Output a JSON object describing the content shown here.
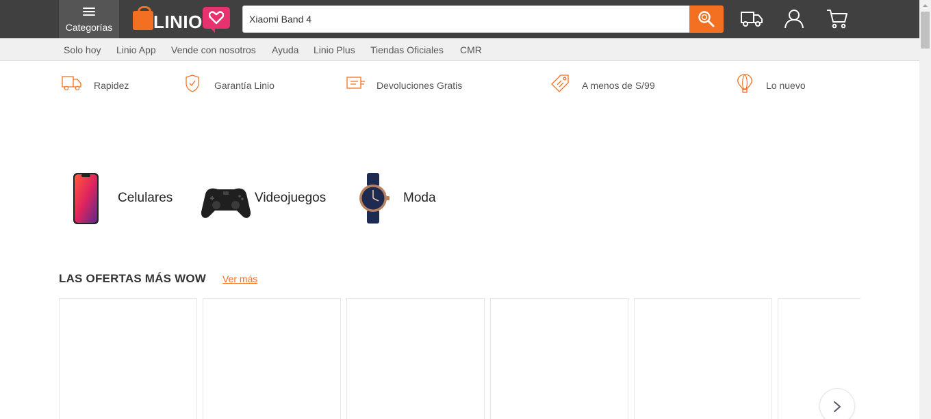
{
  "header": {
    "categories_label": "Categorías",
    "logo_text": "LINIO",
    "search_value": "Xiaomi Band 4"
  },
  "subnav": [
    "Solo hoy",
    "Linio App",
    "Vende con nosotros",
    "Ayuda",
    "Linio Plus",
    "Tiendas Oficiales",
    "CMR"
  ],
  "benefits": [
    "Rapidez",
    "Garantía Linio",
    "Devoluciones Gratis",
    "A menos de S/99",
    "Lo nuevo"
  ],
  "categories": [
    "Celulares",
    "Videojuegos",
    "Moda"
  ],
  "offers": {
    "title": "LAS OFERTAS MÁS WOW",
    "link": "Ver más"
  },
  "colors": {
    "accent": "#f36f21",
    "header_bg": "#404040",
    "heart": "#e6326e"
  }
}
